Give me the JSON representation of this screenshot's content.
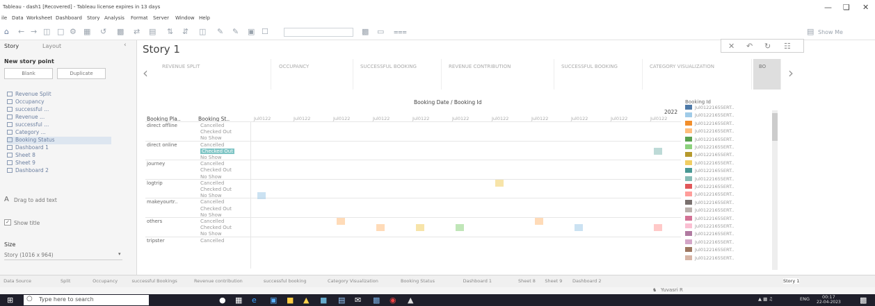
{
  "window": {
    "title": "Tableau - dash1 [Recovered] - Tableau license expires in 13 days"
  },
  "menu": [
    "ile",
    "Data",
    "Worksheet",
    "Dashboard",
    "Story",
    "Analysis",
    "Format",
    "Server",
    "Window",
    "Help"
  ],
  "toolbar": {
    "show_me": "Show Me"
  },
  "left_panel": {
    "tab_story": "Story",
    "tab_layout": "Layout",
    "new_story_point": "New story point",
    "blank_btn": "Blank",
    "duplicate_btn": "Duplicate",
    "sheets": [
      "Revenue Split",
      "Occupancy",
      "successful ...",
      "Revenue ...",
      "successful ...",
      "Category ...",
      "Booking Status",
      "Dashboard 1",
      "Sheet 8",
      "Sheet 9",
      "Dashboard 2"
    ],
    "drag_text": "Drag to add text",
    "show_title": "Show title",
    "size_label": "Size",
    "size_value": "Story (1016 x 964)"
  },
  "story": {
    "title": "Story 1",
    "points": [
      "REVENUE SPLIT",
      "OCCUPANCY",
      "SUCCESSFUL BOOKING",
      "REVENUE CONTRIBUTION",
      "SUCCESSFUL BOOKING",
      "CATEGORY VISUALIZATION",
      "BO"
    ]
  },
  "viz": {
    "top_header": "Booking Date / Booking Id",
    "year": "2022",
    "col_header_1": "Booking Pla..",
    "col_header_2": "Booking St..",
    "col_label": "Jul0122",
    "groups": [
      "direct offline",
      "direct online",
      "journey",
      "logtrip",
      "makeyourtr..",
      "others",
      "tripster"
    ],
    "statuses": [
      "Cancelled",
      "Checked Out",
      "No Show"
    ]
  },
  "legend": {
    "title": "Booking Id",
    "item_label": "Jul01221655ERT..",
    "colors": [
      "#4e79a7",
      "#a0cbe8",
      "#f28e2b",
      "#ffbe7d",
      "#59a14f",
      "#8cd17d",
      "#b6992d",
      "#f1ce63",
      "#499894",
      "#86bcb6",
      "#e15759",
      "#ff9d9a",
      "#79706e",
      "#bab0ac",
      "#d37295",
      "#fabfd2",
      "#b07aa1",
      "#d4a6c8",
      "#9d7660",
      "#d7b5a6"
    ]
  },
  "sheet_tabs": [
    "Data Source",
    "Split",
    "Occupancy",
    "successful Bookings",
    "Revenue contribution",
    "successful booking",
    "Category Visualization",
    "Booking Status",
    "Dashboard 1",
    "Sheet 8",
    "Sheet 9",
    "Dashboard 2",
    "Story 1"
  ],
  "status": {
    "user": "Yuvasri R"
  },
  "taskbar": {
    "search_placeholder": "Type here to search",
    "lang": "ENG",
    "time": "00:17",
    "date": "22-04-2023"
  }
}
